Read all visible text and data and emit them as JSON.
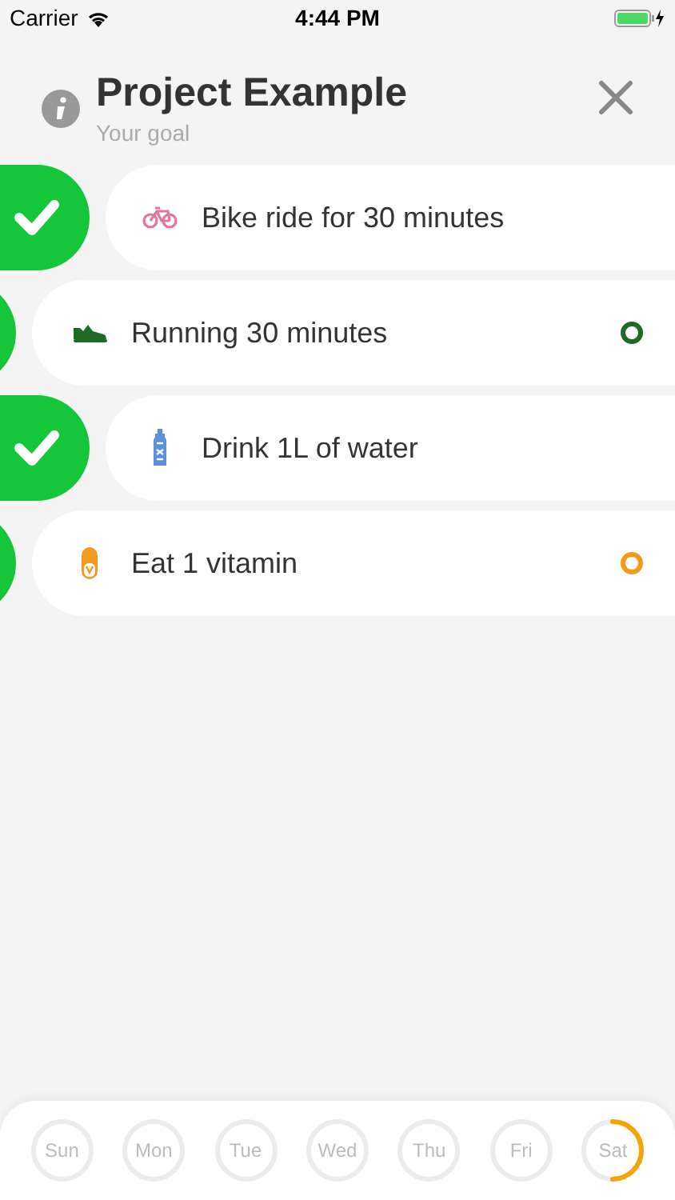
{
  "status_bar": {
    "carrier": "Carrier",
    "time": "4:44 PM"
  },
  "header": {
    "title": "Project Example",
    "subtitle": "Your goal"
  },
  "tasks": [
    {
      "kind": "bike",
      "label": "Bike ride for 30 minutes",
      "checked": true,
      "color": "#e5739a"
    },
    {
      "kind": "shoe",
      "label": "Running 30 minutes",
      "checked": false,
      "color": "#1f6b25"
    },
    {
      "kind": "bottle",
      "label": "Drink 1L of water",
      "checked": true,
      "color": "#5b8fe0"
    },
    {
      "kind": "pill",
      "label": "Eat 1 vitamin",
      "checked": false,
      "color": "#f29a1e"
    }
  ],
  "days": [
    {
      "label": "Sun"
    },
    {
      "label": "Mon"
    },
    {
      "label": "Tue"
    },
    {
      "label": "Wed"
    },
    {
      "label": "Thu"
    },
    {
      "label": "Fri"
    },
    {
      "label": "Sat",
      "level": 0.5
    }
  ]
}
